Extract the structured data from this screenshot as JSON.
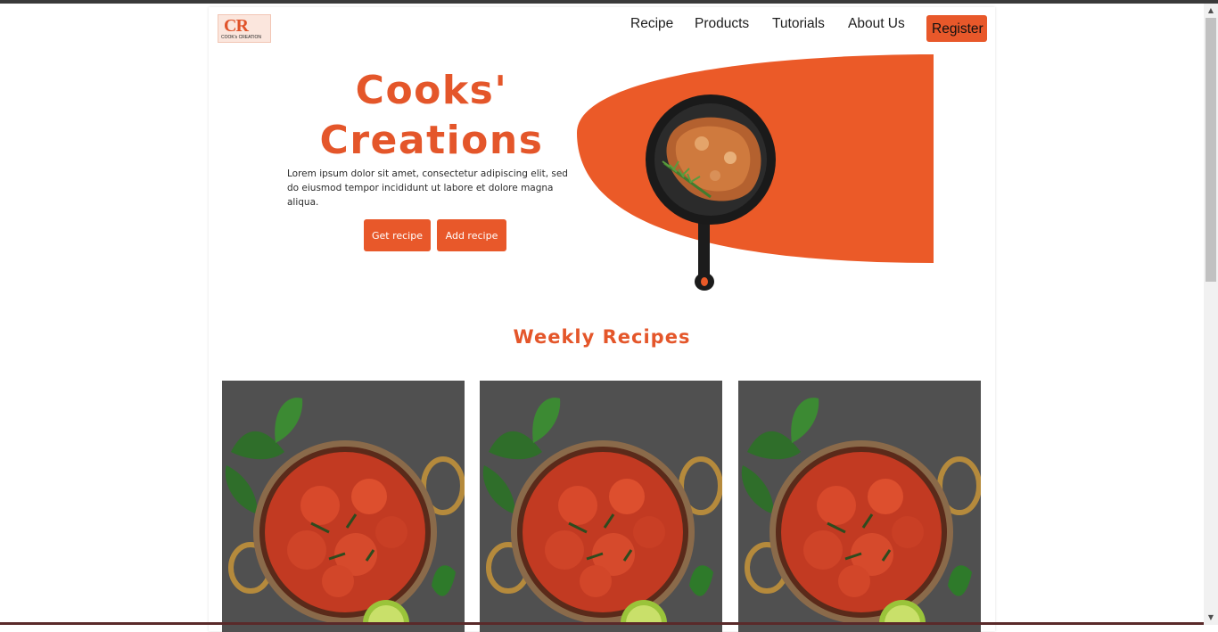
{
  "logo": {
    "mark": "CR",
    "text": "COOK's CREATION"
  },
  "nav": {
    "items": [
      {
        "label": "Recipe"
      },
      {
        "label": "Products"
      },
      {
        "label": "Tutorials"
      },
      {
        "label": "About Us"
      }
    ],
    "register_label": "Register"
  },
  "hero": {
    "title_line1": "Cooks'",
    "title_line2": "Creations",
    "description": "Lorem ipsum dolor sit amet, consectetur adipiscing elit, sed do eiusmod tempor incididunt ut labore et dolore magna aliqua.",
    "get_recipe_label": "Get recipe",
    "add_recipe_label": "Add recipe"
  },
  "weekly": {
    "title": "Weekly Recipes",
    "card_count": 3
  },
  "colors": {
    "accent": "#e8582a",
    "title": "#e4562a"
  },
  "icons": {
    "scroll_up": "triangle-up-icon",
    "scroll_down": "triangle-down-icon"
  }
}
